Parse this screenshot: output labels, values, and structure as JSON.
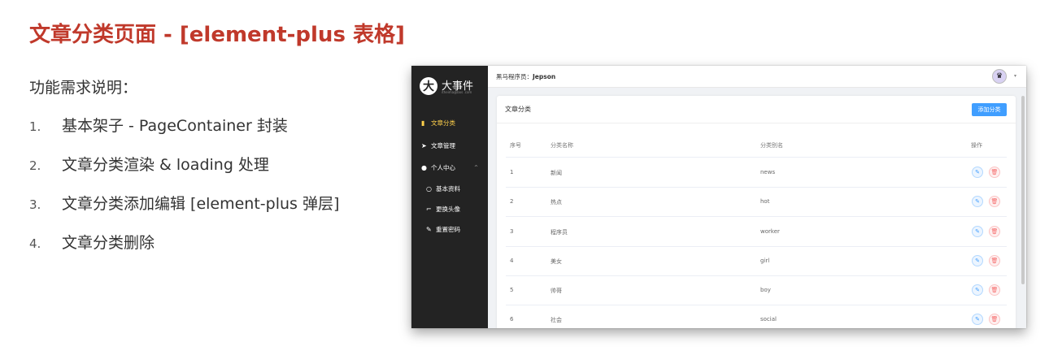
{
  "slide": {
    "title": "文章分类页面 - [element-plus 表格]",
    "requirements_heading": "功能需求说明：",
    "requirements": [
      {
        "num": "1.",
        "text": "基本架子 - PageContainer 封装"
      },
      {
        "num": "2.",
        "text": "文章分类渲染 & loading 处理"
      },
      {
        "num": "3.",
        "text": "文章分类添加编辑 [element-plus 弹层]"
      },
      {
        "num": "4.",
        "text": "文章分类删除"
      }
    ]
  },
  "app": {
    "logo_text": "大事件",
    "logo_sub": "itheima@bos .com",
    "user_prefix": "黑马程序员：",
    "user_name": "Jepson",
    "menu": [
      {
        "label": "文章分类",
        "icon": "book-icon",
        "active": true
      },
      {
        "label": "文章管理",
        "icon": "paper-plane-icon"
      },
      {
        "label": "个人中心",
        "icon": "user-icon"
      },
      {
        "label": "基本资料",
        "icon": "user-outline-icon"
      },
      {
        "label": "更换头像",
        "icon": "crop-icon"
      },
      {
        "label": "重置密码",
        "icon": "edit-pen-icon"
      }
    ],
    "card_title": "文章分类",
    "add_button": "添加分类",
    "columns": [
      "序号",
      "分类名称",
      "分类别名",
      "操作"
    ],
    "rows": [
      {
        "index": "1",
        "name": "新闻",
        "alias": "news"
      },
      {
        "index": "2",
        "name": "热点",
        "alias": "hot"
      },
      {
        "index": "3",
        "name": "程序员",
        "alias": "worker"
      },
      {
        "index": "4",
        "name": "美女",
        "alias": "girl"
      },
      {
        "index": "5",
        "name": "帅哥",
        "alias": "boy"
      },
      {
        "index": "6",
        "name": "社会",
        "alias": "social"
      }
    ],
    "colors": {
      "accent": "#409eff",
      "danger": "#f56c6c",
      "sidebar": "#232323",
      "active_menu": "#ffd04b",
      "title": "#c0392b"
    }
  }
}
